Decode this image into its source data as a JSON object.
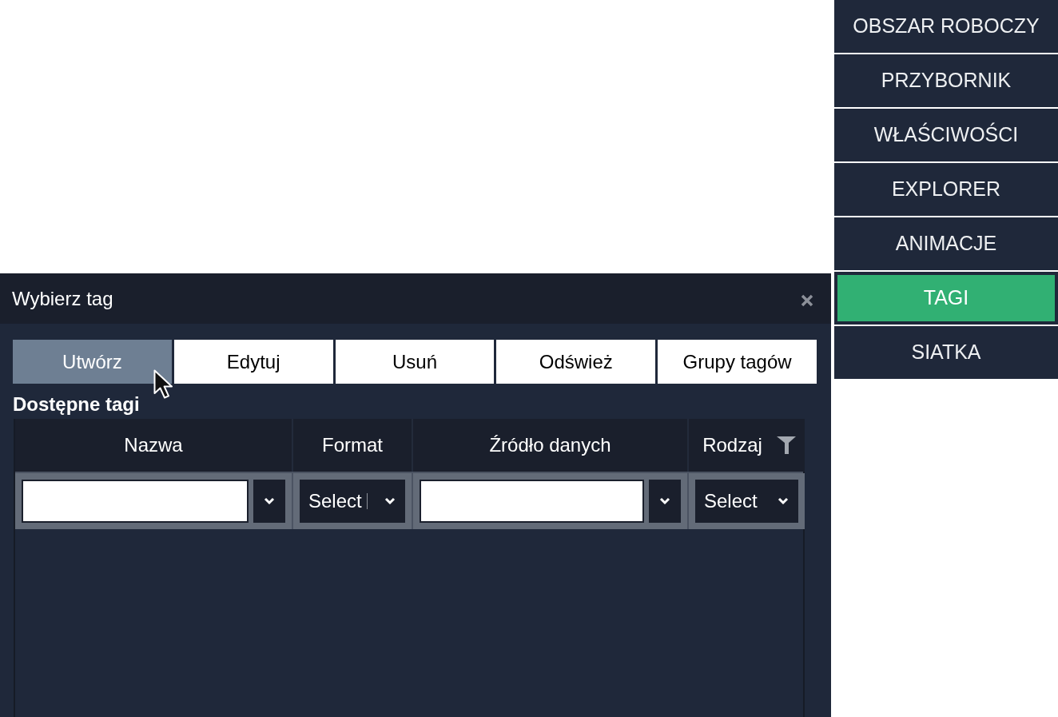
{
  "sidebar": {
    "items": [
      {
        "label": "OBSZAR ROBOCZY",
        "selected": false
      },
      {
        "label": "PRZYBORNIK",
        "selected": false
      },
      {
        "label": "WŁAŚCIWOŚCI",
        "selected": false
      },
      {
        "label": "EXPLORER",
        "selected": false
      },
      {
        "label": "ANIMACJE",
        "selected": false
      },
      {
        "label": "TAGI",
        "selected": true
      },
      {
        "label": "SIATKA",
        "selected": false
      }
    ]
  },
  "dialog": {
    "title": "Wybierz tag",
    "toolbar": [
      {
        "label": "Utwórz",
        "hovered": true
      },
      {
        "label": "Edytuj",
        "hovered": false
      },
      {
        "label": "Usuń",
        "hovered": false
      },
      {
        "label": "Odśwież",
        "hovered": false
      },
      {
        "label": "Grupy tagów",
        "hovered": false
      }
    ],
    "section_title": "Dostępne tagi",
    "table": {
      "columns": [
        {
          "label": "Nazwa",
          "filter_icon": false,
          "filter": {
            "kind": "combo"
          }
        },
        {
          "label": "Format",
          "filter_icon": false,
          "filter": {
            "kind": "select",
            "value": "Select",
            "divider": true
          }
        },
        {
          "label": "Źródło danych",
          "filter_icon": false,
          "filter": {
            "kind": "combo"
          }
        },
        {
          "label": "Rodzaj",
          "filter_icon": true,
          "filter": {
            "kind": "select",
            "value": "Select",
            "divider": false
          }
        }
      ]
    }
  }
}
